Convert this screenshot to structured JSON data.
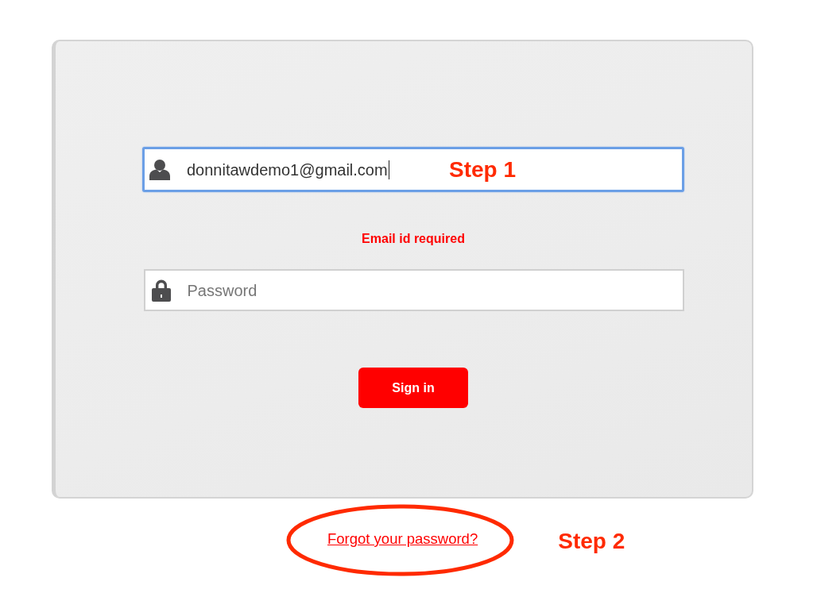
{
  "login_card": {
    "email_field": {
      "value": "donnitawdemo1@gmail.com",
      "focused": true,
      "annotation": "Step 1"
    },
    "error_message": "Email id required",
    "password_field": {
      "placeholder": "Password"
    },
    "sign_in_button": {
      "label": "Sign in"
    }
  },
  "forgot_password_link": {
    "label": "Forgot your password?",
    "circled": true,
    "annotation": "Step 2"
  }
}
